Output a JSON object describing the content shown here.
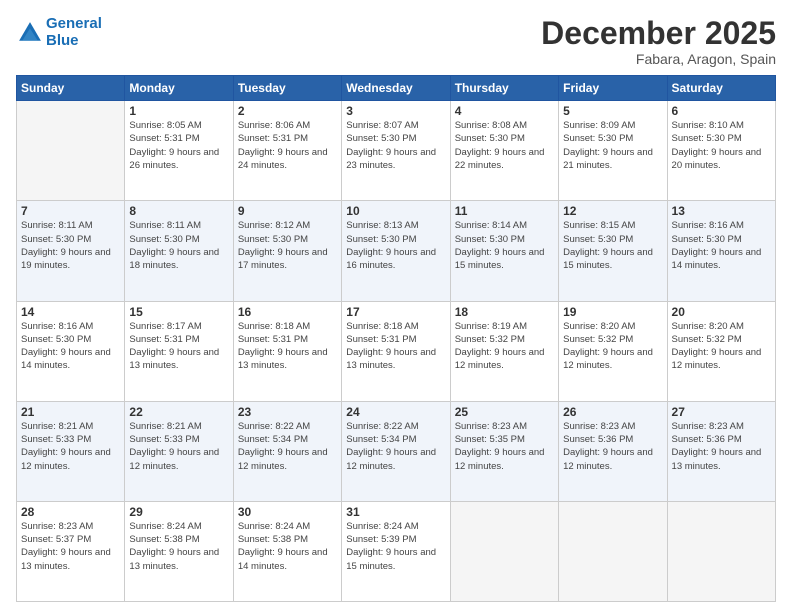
{
  "header": {
    "logo_line1": "General",
    "logo_line2": "Blue",
    "month": "December 2025",
    "location": "Fabara, Aragon, Spain"
  },
  "weekdays": [
    "Sunday",
    "Monday",
    "Tuesday",
    "Wednesday",
    "Thursday",
    "Friday",
    "Saturday"
  ],
  "weeks": [
    [
      {
        "day": "",
        "empty": true
      },
      {
        "day": "1",
        "sunrise": "8:05 AM",
        "sunset": "5:31 PM",
        "daylight": "9 hours and 26 minutes."
      },
      {
        "day": "2",
        "sunrise": "8:06 AM",
        "sunset": "5:31 PM",
        "daylight": "9 hours and 24 minutes."
      },
      {
        "day": "3",
        "sunrise": "8:07 AM",
        "sunset": "5:30 PM",
        "daylight": "9 hours and 23 minutes."
      },
      {
        "day": "4",
        "sunrise": "8:08 AM",
        "sunset": "5:30 PM",
        "daylight": "9 hours and 22 minutes."
      },
      {
        "day": "5",
        "sunrise": "8:09 AM",
        "sunset": "5:30 PM",
        "daylight": "9 hours and 21 minutes."
      },
      {
        "day": "6",
        "sunrise": "8:10 AM",
        "sunset": "5:30 PM",
        "daylight": "9 hours and 20 minutes."
      }
    ],
    [
      {
        "day": "7",
        "sunrise": "8:11 AM",
        "sunset": "5:30 PM",
        "daylight": "9 hours and 19 minutes."
      },
      {
        "day": "8",
        "sunrise": "8:11 AM",
        "sunset": "5:30 PM",
        "daylight": "9 hours and 18 minutes."
      },
      {
        "day": "9",
        "sunrise": "8:12 AM",
        "sunset": "5:30 PM",
        "daylight": "9 hours and 17 minutes."
      },
      {
        "day": "10",
        "sunrise": "8:13 AM",
        "sunset": "5:30 PM",
        "daylight": "9 hours and 16 minutes."
      },
      {
        "day": "11",
        "sunrise": "8:14 AM",
        "sunset": "5:30 PM",
        "daylight": "9 hours and 15 minutes."
      },
      {
        "day": "12",
        "sunrise": "8:15 AM",
        "sunset": "5:30 PM",
        "daylight": "9 hours and 15 minutes."
      },
      {
        "day": "13",
        "sunrise": "8:16 AM",
        "sunset": "5:30 PM",
        "daylight": "9 hours and 14 minutes."
      }
    ],
    [
      {
        "day": "14",
        "sunrise": "8:16 AM",
        "sunset": "5:30 PM",
        "daylight": "9 hours and 14 minutes."
      },
      {
        "day": "15",
        "sunrise": "8:17 AM",
        "sunset": "5:31 PM",
        "daylight": "9 hours and 13 minutes."
      },
      {
        "day": "16",
        "sunrise": "8:18 AM",
        "sunset": "5:31 PM",
        "daylight": "9 hours and 13 minutes."
      },
      {
        "day": "17",
        "sunrise": "8:18 AM",
        "sunset": "5:31 PM",
        "daylight": "9 hours and 13 minutes."
      },
      {
        "day": "18",
        "sunrise": "8:19 AM",
        "sunset": "5:32 PM",
        "daylight": "9 hours and 12 minutes."
      },
      {
        "day": "19",
        "sunrise": "8:20 AM",
        "sunset": "5:32 PM",
        "daylight": "9 hours and 12 minutes."
      },
      {
        "day": "20",
        "sunrise": "8:20 AM",
        "sunset": "5:32 PM",
        "daylight": "9 hours and 12 minutes."
      }
    ],
    [
      {
        "day": "21",
        "sunrise": "8:21 AM",
        "sunset": "5:33 PM",
        "daylight": "9 hours and 12 minutes."
      },
      {
        "day": "22",
        "sunrise": "8:21 AM",
        "sunset": "5:33 PM",
        "daylight": "9 hours and 12 minutes."
      },
      {
        "day": "23",
        "sunrise": "8:22 AM",
        "sunset": "5:34 PM",
        "daylight": "9 hours and 12 minutes."
      },
      {
        "day": "24",
        "sunrise": "8:22 AM",
        "sunset": "5:34 PM",
        "daylight": "9 hours and 12 minutes."
      },
      {
        "day": "25",
        "sunrise": "8:23 AM",
        "sunset": "5:35 PM",
        "daylight": "9 hours and 12 minutes."
      },
      {
        "day": "26",
        "sunrise": "8:23 AM",
        "sunset": "5:36 PM",
        "daylight": "9 hours and 12 minutes."
      },
      {
        "day": "27",
        "sunrise": "8:23 AM",
        "sunset": "5:36 PM",
        "daylight": "9 hours and 13 minutes."
      }
    ],
    [
      {
        "day": "28",
        "sunrise": "8:23 AM",
        "sunset": "5:37 PM",
        "daylight": "9 hours and 13 minutes."
      },
      {
        "day": "29",
        "sunrise": "8:24 AM",
        "sunset": "5:38 PM",
        "daylight": "9 hours and 13 minutes."
      },
      {
        "day": "30",
        "sunrise": "8:24 AM",
        "sunset": "5:38 PM",
        "daylight": "9 hours and 14 minutes."
      },
      {
        "day": "31",
        "sunrise": "8:24 AM",
        "sunset": "5:39 PM",
        "daylight": "9 hours and 15 minutes."
      },
      {
        "day": "",
        "empty": true
      },
      {
        "day": "",
        "empty": true
      },
      {
        "day": "",
        "empty": true
      }
    ]
  ]
}
